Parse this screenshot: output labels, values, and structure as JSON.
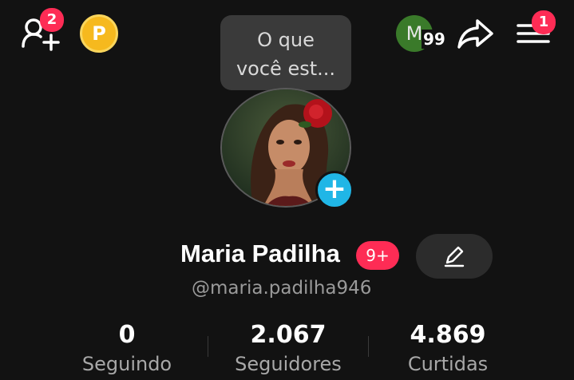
{
  "header": {
    "friend_requests_badge": "2",
    "coin_label": "P",
    "note_placeholder_line1": "O que",
    "note_placeholder_line2": "você est...",
    "account_avatar_letter": "M",
    "account_avatar_count": "99",
    "menu_badge": "1"
  },
  "profile": {
    "display_name": "Maria Padilha",
    "name_badge": "9+",
    "username": "@maria.padilha946",
    "add_story_symbol": "+"
  },
  "stats": [
    {
      "value": "0",
      "label": "Seguindo"
    },
    {
      "value": "2.067",
      "label": "Seguidores"
    },
    {
      "value": "4.869",
      "label": "Curtidas"
    }
  ],
  "colors": {
    "background": "#121212",
    "badge_red": "#fe2c55",
    "add_story_blue": "#20b6e6",
    "coin_gold": "#f6b91e",
    "account_green": "#3a7a2a"
  },
  "icons": [
    "add-friend-icon",
    "coin-icon",
    "share-icon",
    "menu-icon",
    "edit-pencil-icon",
    "plus-icon"
  ]
}
